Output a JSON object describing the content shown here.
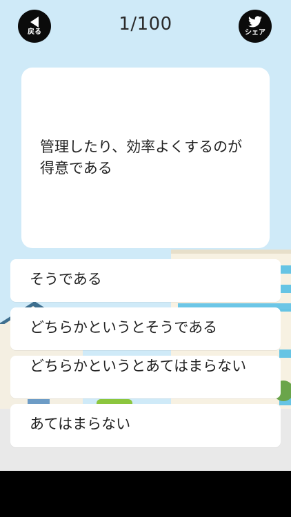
{
  "header": {
    "back_label": "戻る",
    "counter": "1/100",
    "share_label": "シェア"
  },
  "question": {
    "text": "管理したり、効率よくするのが得意である"
  },
  "answers": [
    {
      "label": "そうである"
    },
    {
      "label": "どちらかというとそうである"
    },
    {
      "label": "どちらかというとあてはまらない"
    },
    {
      "label": "あてはまらない"
    }
  ],
  "colors": {
    "sky": "#cfeaf8",
    "button_bg": "#0b0b0b",
    "card_bg": "#ffffff",
    "text": "#222222"
  }
}
